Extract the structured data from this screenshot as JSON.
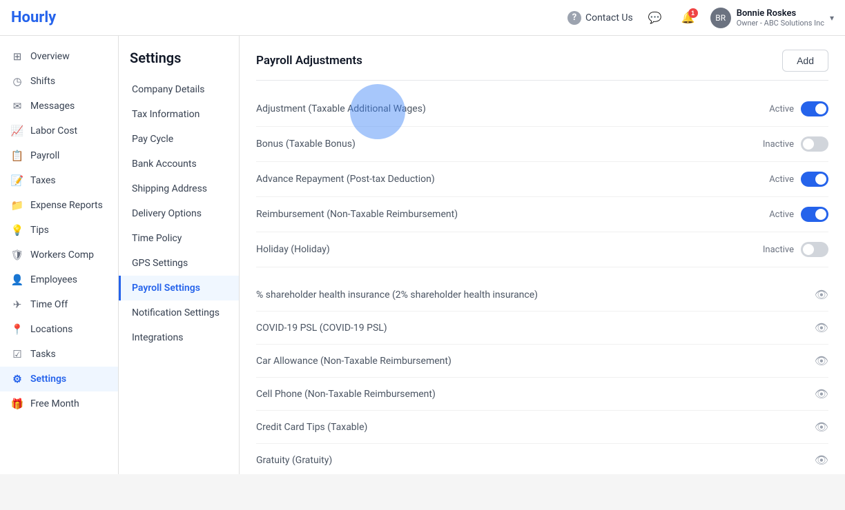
{
  "header": {
    "logo": "Hourly",
    "contact_label": "Contact Us",
    "notification_count": "1",
    "user": {
      "name": "Bonnie Roskes",
      "role": "Owner - ABC Solutions Inc",
      "initials": "BR"
    }
  },
  "sidebar": {
    "items": [
      {
        "id": "overview",
        "label": "Overview",
        "icon": "⊞"
      },
      {
        "id": "shifts",
        "label": "Shifts",
        "icon": "◷"
      },
      {
        "id": "messages",
        "label": "Messages",
        "icon": "✉"
      },
      {
        "id": "labor-cost",
        "label": "Labor Cost",
        "icon": "📈"
      },
      {
        "id": "payroll",
        "label": "Payroll",
        "icon": "📋"
      },
      {
        "id": "taxes",
        "label": "Taxes",
        "icon": "🗒"
      },
      {
        "id": "expense-reports",
        "label": "Expense Reports",
        "icon": "📁"
      },
      {
        "id": "tips",
        "label": "Tips",
        "icon": "💡"
      },
      {
        "id": "workers-comp",
        "label": "Workers Comp",
        "icon": "🛡"
      },
      {
        "id": "employees",
        "label": "Employees",
        "icon": "👤"
      },
      {
        "id": "time-off",
        "label": "Time Off",
        "icon": "✈"
      },
      {
        "id": "locations",
        "label": "Locations",
        "icon": "📍"
      },
      {
        "id": "tasks",
        "label": "Tasks",
        "icon": "📋"
      },
      {
        "id": "settings",
        "label": "Settings",
        "icon": "⚙"
      },
      {
        "id": "free-month",
        "label": "Free Month",
        "icon": "🎁"
      }
    ]
  },
  "settings": {
    "title": "Settings",
    "nav": [
      {
        "id": "company-details",
        "label": "Company Details"
      },
      {
        "id": "tax-information",
        "label": "Tax Information"
      },
      {
        "id": "pay-cycle",
        "label": "Pay Cycle"
      },
      {
        "id": "bank-accounts",
        "label": "Bank Accounts"
      },
      {
        "id": "shipping-address",
        "label": "Shipping Address"
      },
      {
        "id": "delivery-options",
        "label": "Delivery Options"
      },
      {
        "id": "time-policy",
        "label": "Time Policy"
      },
      {
        "id": "gps-settings",
        "label": "GPS Settings"
      },
      {
        "id": "payroll-settings",
        "label": "Payroll Settings",
        "active": true
      },
      {
        "id": "notification-settings",
        "label": "Notification Settings"
      },
      {
        "id": "integrations",
        "label": "Integrations"
      }
    ],
    "payroll_adjustments": {
      "title": "Payroll Adjustments",
      "add_button": "Add",
      "active_rows": [
        {
          "name": "Adjustment (Taxable Additional Wages)",
          "status": "Active",
          "on": true
        },
        {
          "name": "Bonus (Taxable Bonus)",
          "status": "Inactive",
          "on": false
        },
        {
          "name": "Advance Repayment (Post-tax Deduction)",
          "status": "Active",
          "on": true
        },
        {
          "name": "Reimbursement (Non-Taxable Reimbursement)",
          "status": "Active",
          "on": true
        },
        {
          "name": "Holiday (Holiday)",
          "status": "Inactive",
          "on": false
        }
      ],
      "eye_rows": [
        {
          "name": "% shareholder health insurance (2% shareholder health insurance)"
        },
        {
          "name": "COVID-19 PSL (COVID-19 PSL)"
        },
        {
          "name": "Car Allowance (Non-Taxable Reimbursement)"
        },
        {
          "name": "Cell Phone (Non-Taxable Reimbursement)"
        },
        {
          "name": "Credit Card Tips (Taxable)"
        },
        {
          "name": "Gratuity (Gratuity)"
        }
      ]
    }
  }
}
